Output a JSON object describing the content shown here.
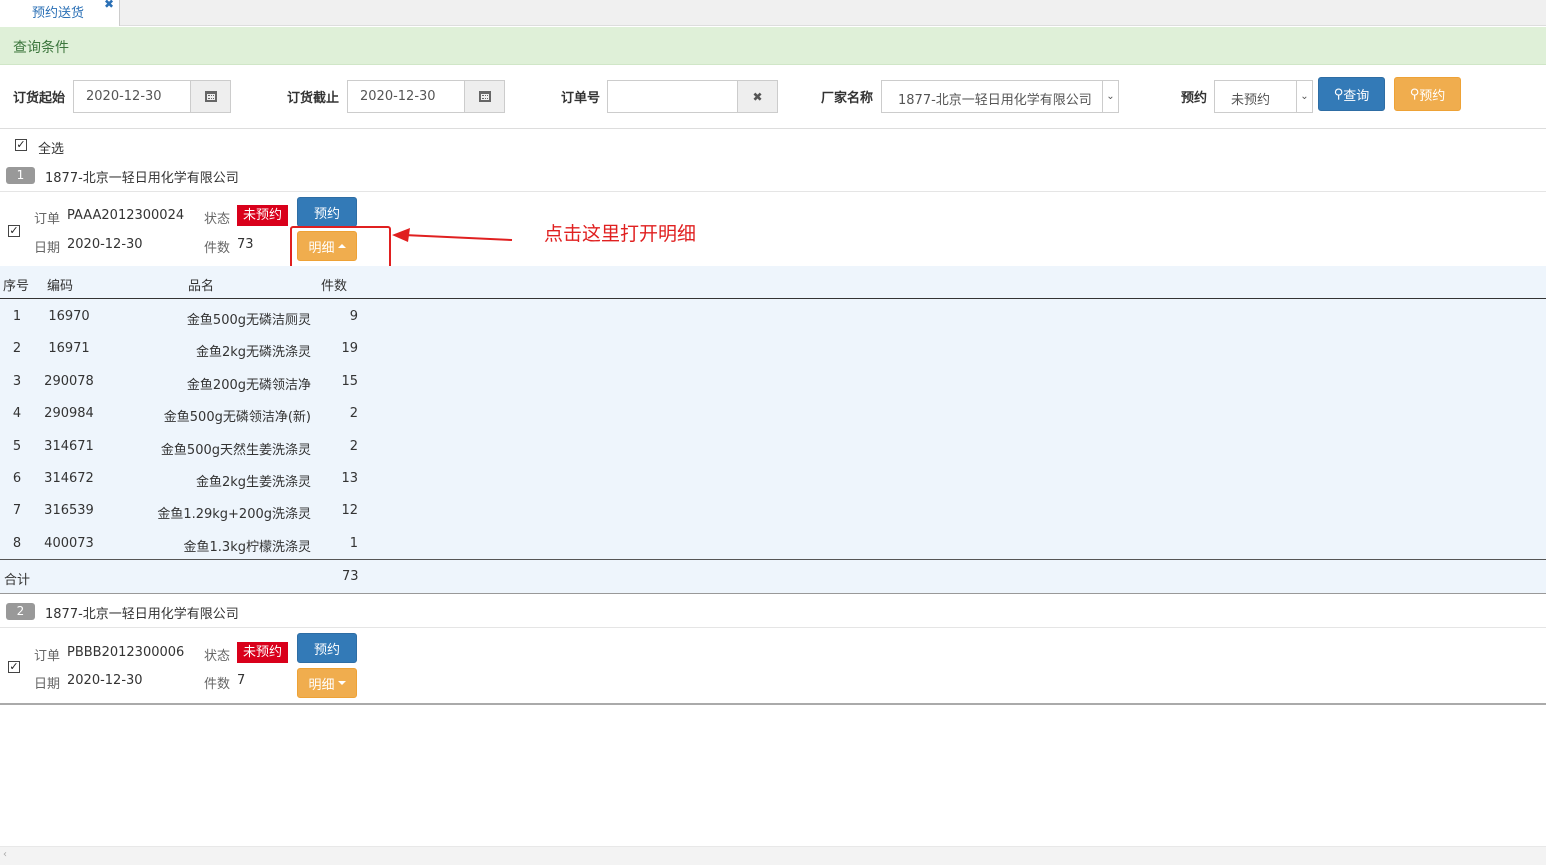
{
  "tab": {
    "label": "预约送货",
    "close": "✖"
  },
  "query": {
    "header": "查询条件",
    "start_label": "订货起始",
    "start_value": "2020-12-30",
    "end_label": "订货截止",
    "end_value": "2020-12-30",
    "order_label": "订单号",
    "order_value": "",
    "clear_glyph": "✖",
    "vendor_label": "厂家名称",
    "vendor_value": "1877-北京一轻日用化学有限公司",
    "reserve_label": "预约",
    "reserve_value": "未预约",
    "query_button": "查询",
    "reserve_button": "预约"
  },
  "select_all": "全选",
  "groups": [
    {
      "index": "1",
      "vendor": "1877-北京一轻日用化学有限公司",
      "order_label": "订单",
      "order_no": "PAAA2012300024",
      "status_label": "状态",
      "status": "未预约",
      "date_label": "日期",
      "date": "2020-12-30",
      "qty_label": "件数",
      "qty": "73",
      "reserve_button": "预约",
      "detail_button": "明细",
      "detail": {
        "headers": {
          "seq": "序号",
          "code": "编码",
          "name": "品名",
          "qty": "件数"
        },
        "rows": [
          {
            "seq": "1",
            "code": "16970",
            "name": "金鱼500g无磷洁厕灵",
            "qty": "9"
          },
          {
            "seq": "2",
            "code": "16971",
            "name": "金鱼2kg无磷洗涤灵",
            "qty": "19"
          },
          {
            "seq": "3",
            "code": "290078",
            "name": "金鱼200g无磷领洁净",
            "qty": "15"
          },
          {
            "seq": "4",
            "code": "290984",
            "name": "金鱼500g无磷领洁净(新)",
            "qty": "2"
          },
          {
            "seq": "5",
            "code": "314671",
            "name": "金鱼500g天然生姜洗涤灵",
            "qty": "2"
          },
          {
            "seq": "6",
            "code": "314672",
            "name": "金鱼2kg生姜洗涤灵",
            "qty": "13"
          },
          {
            "seq": "7",
            "code": "316539",
            "name": "金鱼1.29kg+200g洗涤灵",
            "qty": "12"
          },
          {
            "seq": "8",
            "code": "400073",
            "name": "金鱼1.3kg柠檬洗涤灵",
            "qty": "1"
          }
        ],
        "total_label": "合计",
        "total_qty": "73"
      }
    },
    {
      "index": "2",
      "vendor": "1877-北京一轻日用化学有限公司",
      "order_label": "订单",
      "order_no": "PBBB2012300006",
      "status_label": "状态",
      "status": "未预约",
      "date_label": "日期",
      "date": "2020-12-30",
      "qty_label": "件数",
      "qty": "7",
      "reserve_button": "预约",
      "detail_button": "明细"
    }
  ],
  "annotation": "点击这里打开明细",
  "colors": {
    "primary": "#337ab7",
    "warning": "#f0ad4e",
    "danger": "#d9001b",
    "annotation": "#e02020",
    "query_header_bg": "#dff0d8"
  }
}
